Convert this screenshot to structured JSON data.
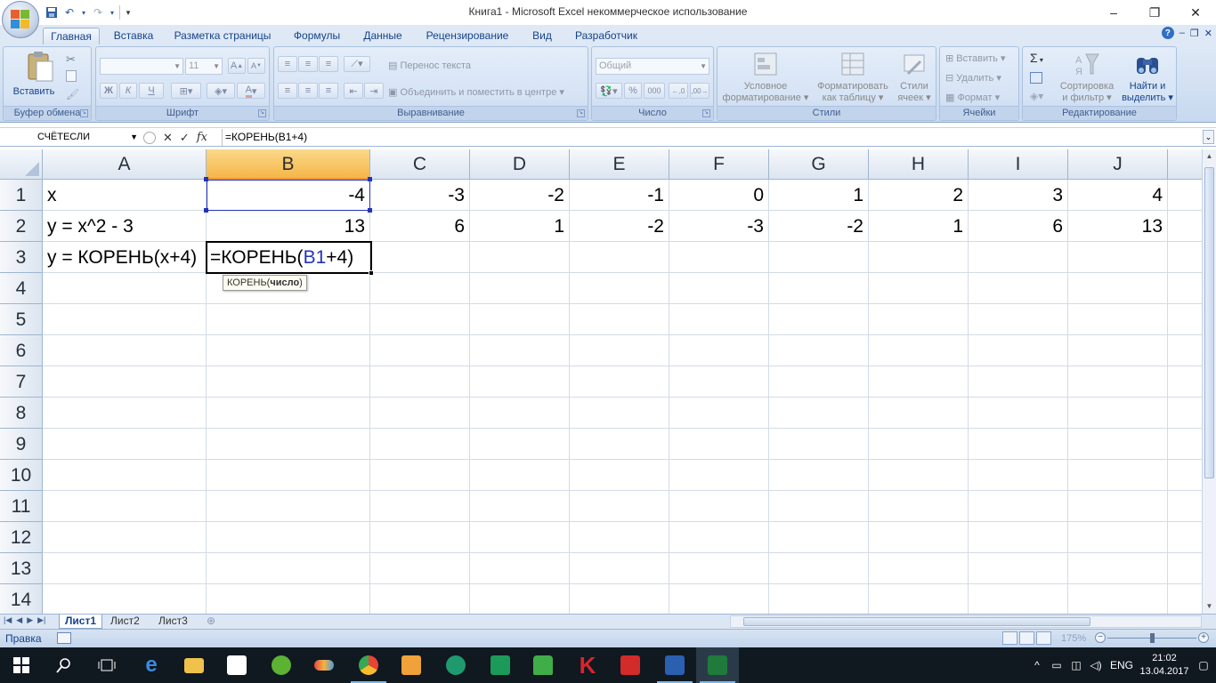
{
  "window": {
    "title": "Книга1 - Microsoft Excel некоммерческое использование",
    "controls": [
      "–",
      "❐",
      "✕"
    ]
  },
  "tabs": [
    "Главная",
    "Вставка",
    "Разметка страницы",
    "Формулы",
    "Данные",
    "Рецензирование",
    "Вид",
    "Разработчик"
  ],
  "ribbon": {
    "clipboard": {
      "paste": "Вставить",
      "label": "Буфер обмена"
    },
    "font": {
      "name": "",
      "size": "11",
      "bold": "Ж",
      "italic": "К",
      "underline": "Ч",
      "label": "Шрифт"
    },
    "alignment": {
      "wrap": "Перенос текста",
      "merge": "Объединить и поместить в центре",
      "label": "Выравнивание"
    },
    "number": {
      "format": "Общий",
      "percent": "%",
      "thousands": "000",
      "label": "Число"
    },
    "styles": {
      "conditional": "Условное\nформатирование",
      "cond1": "Условное",
      "cond2": "форматирование",
      "table1": "Форматировать",
      "table2": "как таблицу",
      "cell1": "Стили",
      "cell2": "ячеек",
      "label": "Стили"
    },
    "cells": {
      "insert": "Вставить",
      "delete": "Удалить",
      "format": "Формат",
      "label": "Ячейки"
    },
    "editing": {
      "sum": "Σ",
      "sort1": "Сортировка",
      "sort2": "и фильтр",
      "find1": "Найти и",
      "find2": "выделить",
      "label": "Редактирование"
    }
  },
  "formula_bar": {
    "name_box": "СЧЁТЕСЛИ",
    "formula": "=КОРЕНЬ(B1+4)",
    "tooltip_fn": "КОРЕНЬ(",
    "tooltip_arg": "число",
    "tooltip_close": ")"
  },
  "columns": [
    "A",
    "B",
    "C",
    "D",
    "E",
    "F",
    "G",
    "H",
    "I",
    "J"
  ],
  "rows": [
    "1",
    "2",
    "3",
    "4",
    "5",
    "6",
    "7",
    "8",
    "9",
    "10",
    "11",
    "12",
    "13",
    "14"
  ],
  "cells": {
    "A1": "x",
    "A2": "y = x^2 - 3",
    "A3": "y = КОРЕНЬ(x+4)",
    "row1": [
      "-4",
      "-3",
      "-2",
      "-1",
      "0",
      "1",
      "2",
      "3",
      "4"
    ],
    "row2": [
      "13",
      "6",
      "1",
      "-2",
      "-3",
      "-2",
      "1",
      "6",
      "13"
    ],
    "B3_prefix": "=КОРЕНЬ(",
    "B3_ref": "B1",
    "B3_suffix": "+4)"
  },
  "sheets": [
    "Лист1",
    "Лист2",
    "Лист3"
  ],
  "status": {
    "mode": "Правка",
    "zoom": "175%"
  },
  "taskbar": {
    "time": "21:02",
    "date": "13.04.2017",
    "lang": "ENG"
  },
  "colors": {
    "accent": "#15428b",
    "selected_header": "#f5b649",
    "reference": "#2233bb"
  }
}
